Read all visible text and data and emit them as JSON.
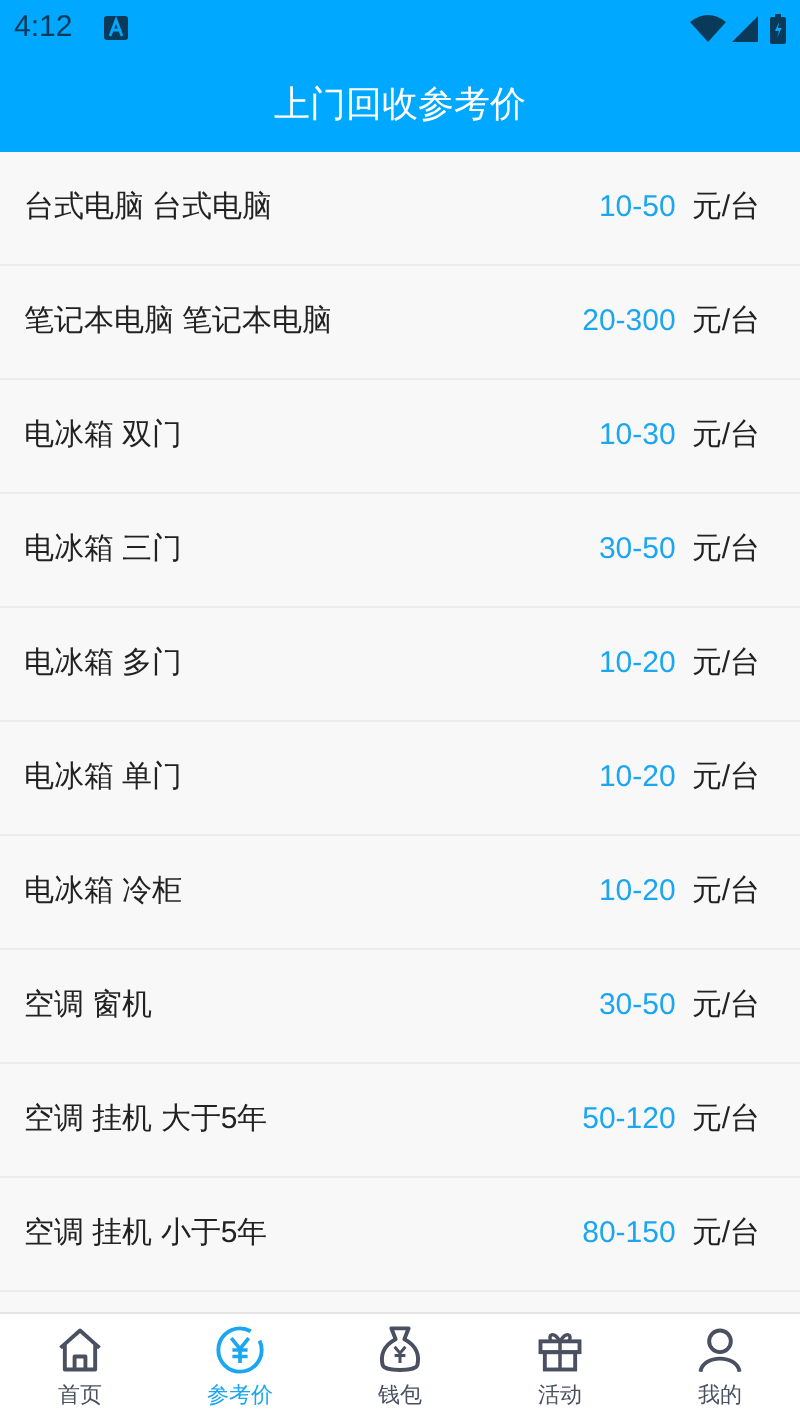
{
  "status_bar": {
    "time": "4:12"
  },
  "header": {
    "title": "上门回收参考价"
  },
  "items": [
    {
      "name": "台式电脑 台式电脑",
      "price": "10-50",
      "unit": "元/台"
    },
    {
      "name": "笔记本电脑 笔记本电脑",
      "price": "20-300",
      "unit": "元/台"
    },
    {
      "name": "电冰箱 双门",
      "price": "10-30",
      "unit": "元/台"
    },
    {
      "name": "电冰箱 三门",
      "price": "30-50",
      "unit": "元/台"
    },
    {
      "name": "电冰箱 多门",
      "price": "10-20",
      "unit": "元/台"
    },
    {
      "name": "电冰箱 单门",
      "price": "10-20",
      "unit": "元/台"
    },
    {
      "name": "电冰箱 冷柜",
      "price": "10-20",
      "unit": "元/台"
    },
    {
      "name": "空调 窗机",
      "price": "30-50",
      "unit": "元/台"
    },
    {
      "name": "空调 挂机 大于5年",
      "price": "50-120",
      "unit": "元/台"
    },
    {
      "name": "空调 挂机 小于5年",
      "price": "80-150",
      "unit": "元/台"
    }
  ],
  "bottom_nav": [
    {
      "kind": "home",
      "label": "首页",
      "selected": false
    },
    {
      "kind": "price",
      "label": "参考价",
      "selected": true
    },
    {
      "kind": "wallet",
      "label": "钱包",
      "selected": false
    },
    {
      "kind": "gift",
      "label": "活动",
      "selected": false
    },
    {
      "kind": "user",
      "label": "我的",
      "selected": false
    }
  ]
}
